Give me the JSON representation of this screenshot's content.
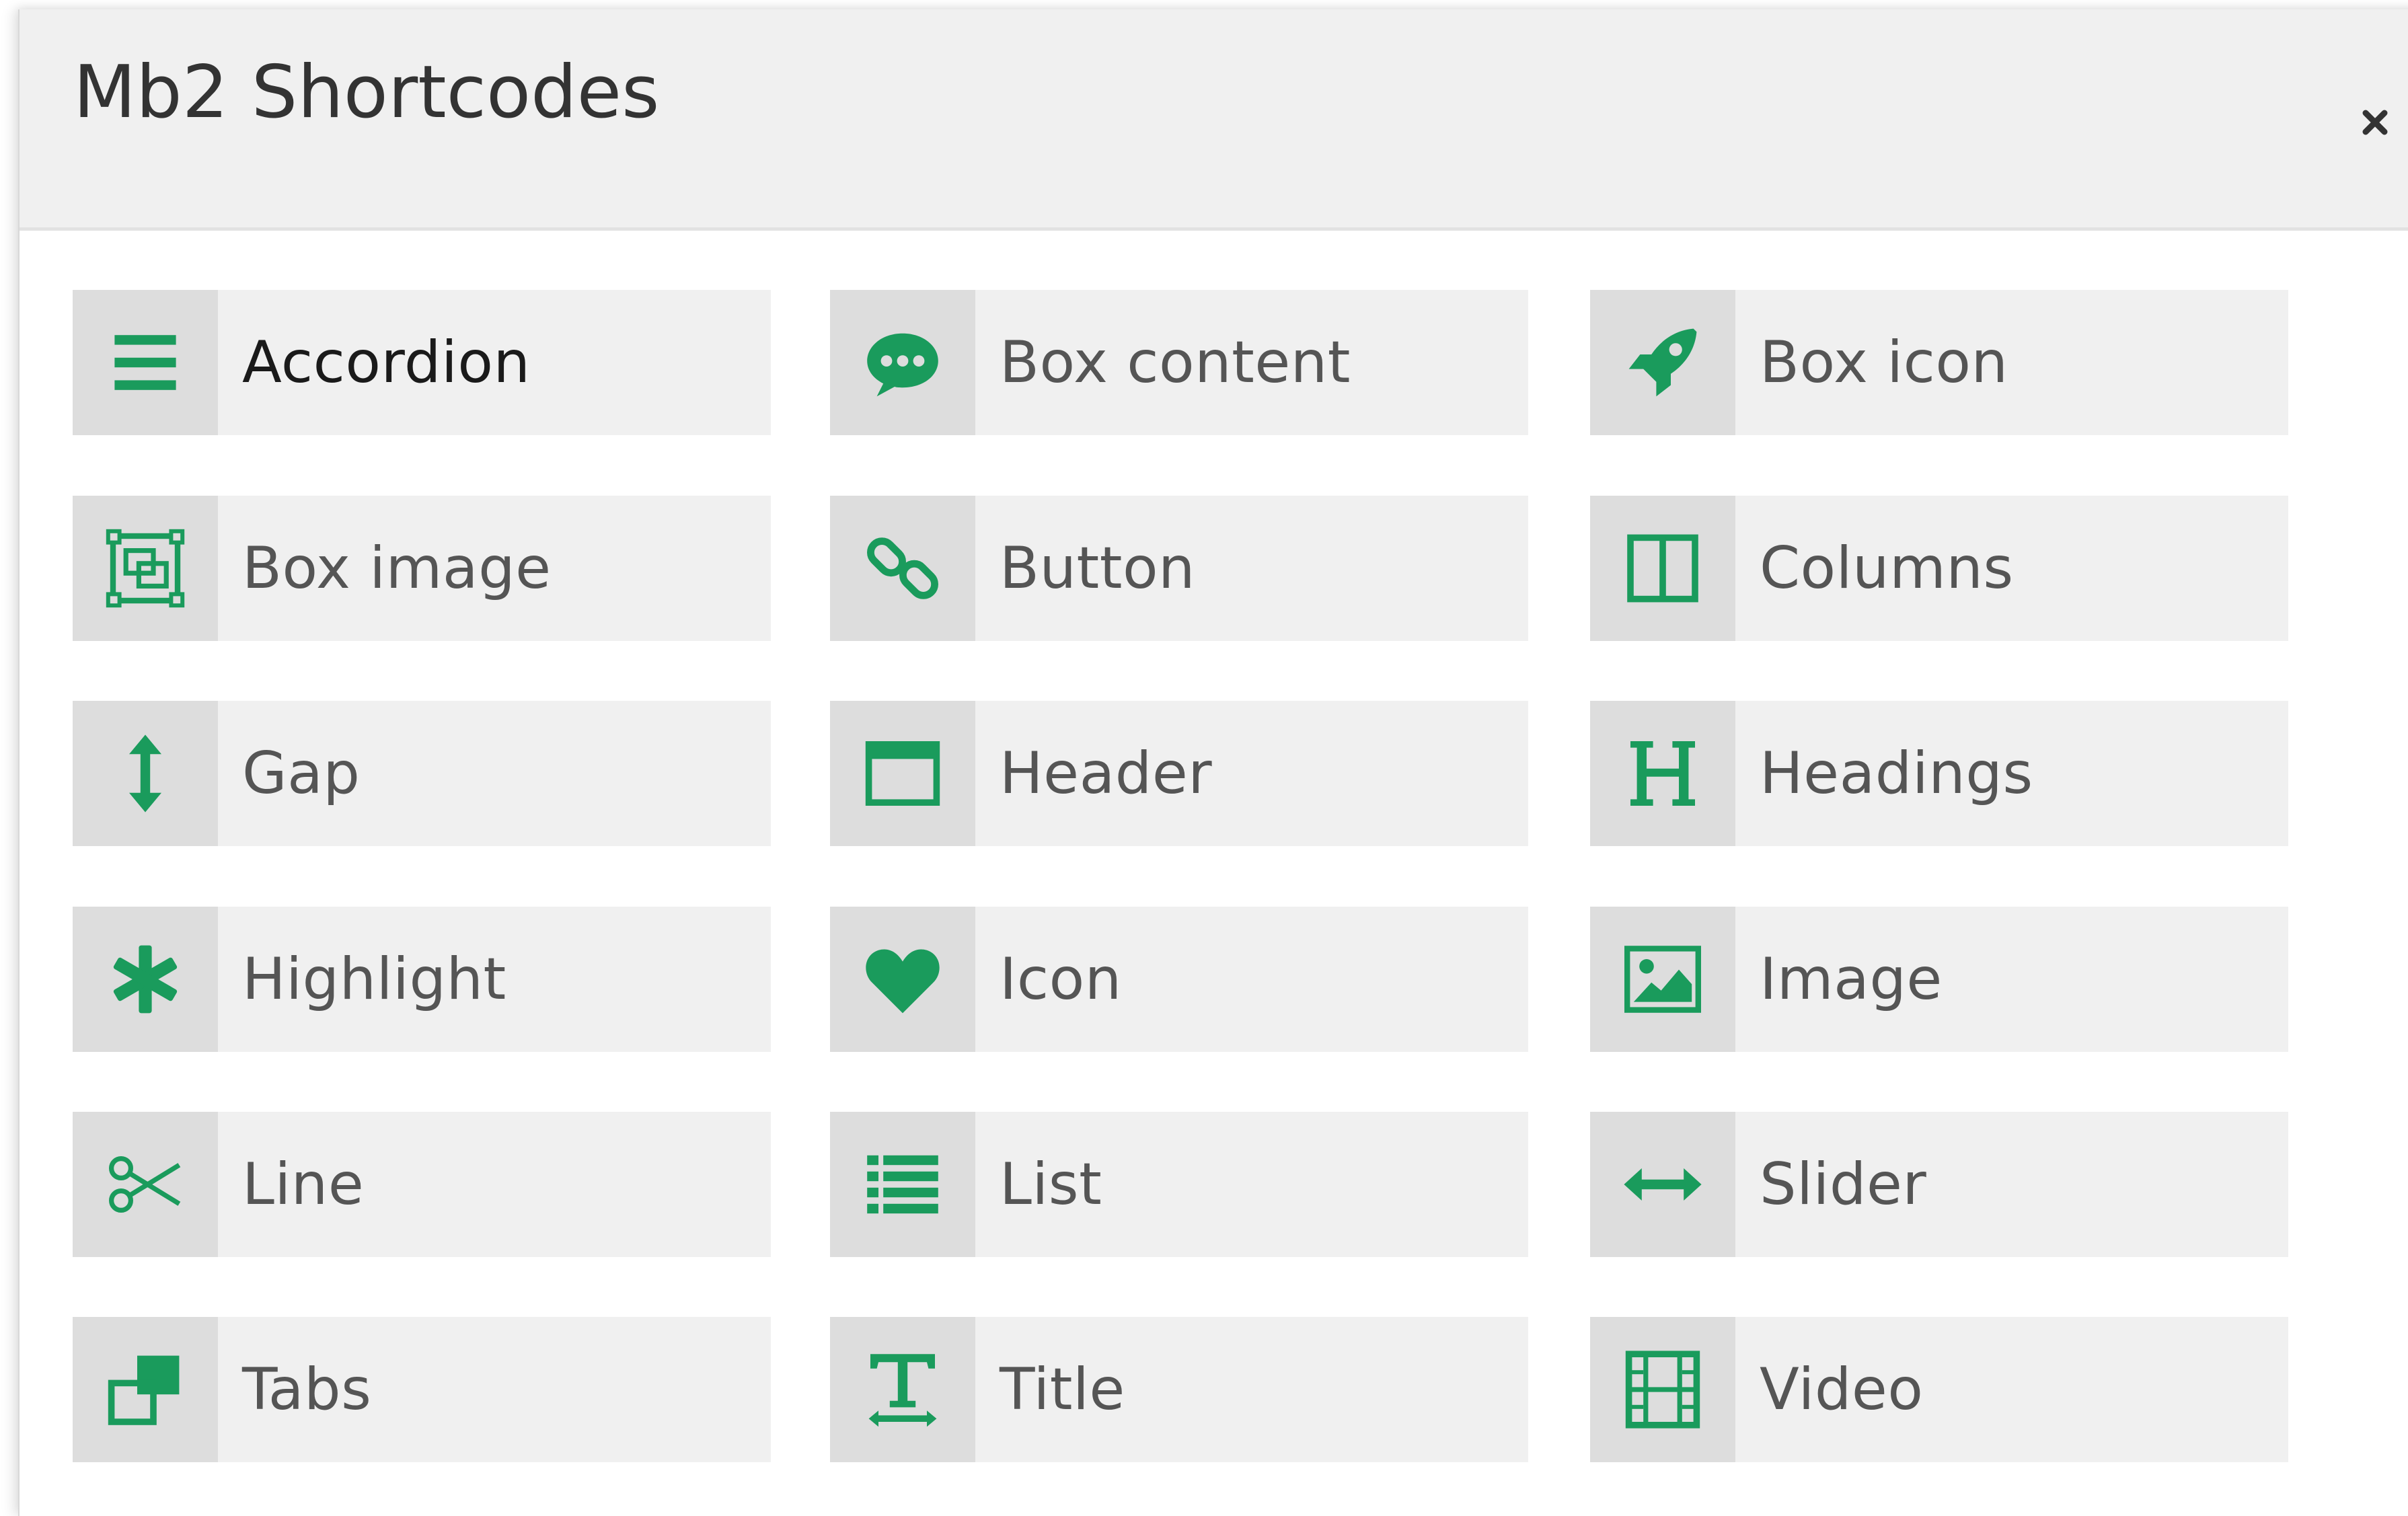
{
  "dialog": {
    "title": "Mb2 Shortcodes",
    "close_symbol": "×"
  },
  "accent_color": "#1a9b5c",
  "items": [
    {
      "label": "Accordion",
      "icon": "bars-icon"
    },
    {
      "label": "Box content",
      "icon": "speech-bubble-icon"
    },
    {
      "label": "Box icon",
      "icon": "rocket-icon"
    },
    {
      "label": "Box image",
      "icon": "object-group-icon"
    },
    {
      "label": "Button",
      "icon": "link-icon"
    },
    {
      "label": "Columns",
      "icon": "columns-icon"
    },
    {
      "label": "Gap",
      "icon": "vertical-arrows-icon"
    },
    {
      "label": "Header",
      "icon": "window-icon"
    },
    {
      "label": "Headings",
      "icon": "heading-icon"
    },
    {
      "label": "Highlight",
      "icon": "asterisk-icon"
    },
    {
      "label": "Icon",
      "icon": "heart-icon"
    },
    {
      "label": "Image",
      "icon": "image-icon"
    },
    {
      "label": "Line",
      "icon": "scissors-icon"
    },
    {
      "label": "List",
      "icon": "list-icon"
    },
    {
      "label": "Slider",
      "icon": "horizontal-arrows-icon"
    },
    {
      "label": "Tabs",
      "icon": "clone-icon"
    },
    {
      "label": "Title",
      "icon": "text-width-icon"
    },
    {
      "label": "Video",
      "icon": "film-icon"
    }
  ]
}
